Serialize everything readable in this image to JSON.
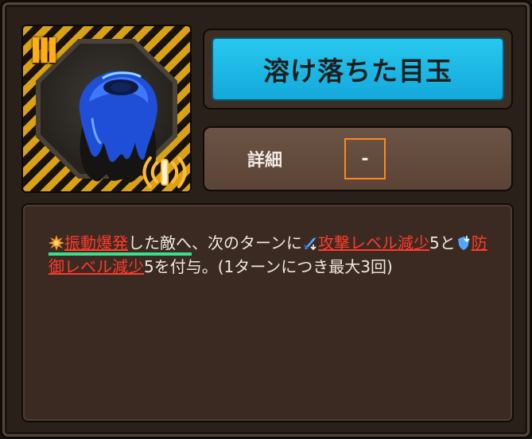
{
  "item": {
    "tier_label": "III",
    "name": "溶け落ちた目玉",
    "image_icon": "melting-eyeball-icon",
    "attribute_icon": "vibration-icon"
  },
  "detail": {
    "label": "詳細",
    "value": "-"
  },
  "description": {
    "part1_keyword": "振動爆発",
    "part2": "した敵へ",
    "part3": "、次のターンに",
    "part4_keyword": "攻撃レベル減少",
    "part5": "5と",
    "part6_keyword": "防御レベル減少",
    "part7": "5を付与。(1ターンにつき最大3回)",
    "icons": [
      "burst-icon",
      "attack-down-icon",
      "defense-down-icon"
    ]
  },
  "colors": {
    "title_bg": "#1bb6e5",
    "keyword": "#ff3b2b",
    "highlight": "#37e08a",
    "accent_orange": "#ff8a1c",
    "hazard_yellow": "#d9a214"
  }
}
